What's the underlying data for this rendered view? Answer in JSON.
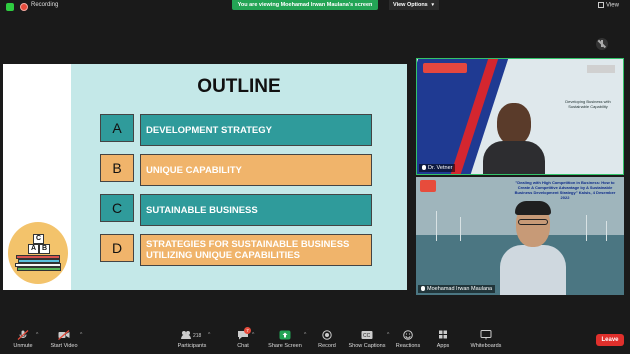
{
  "topbar": {
    "recording_label": "Recording",
    "banner_text": "You are viewing Moehamad Irwan Maulana's screen",
    "view_options_label": "View Options",
    "view_label": "View"
  },
  "slide": {
    "title": "OUTLINE",
    "items": [
      {
        "letter": "A",
        "text": "DEVELOPMENT STRATEGY",
        "color": "#2f9b9b"
      },
      {
        "letter": "B",
        "text": "UNIQUE CAPABILITY",
        "color": "#f0b46b"
      },
      {
        "letter": "C",
        "text": "SUTAINABLE BUSINESS",
        "color": "#2f9b9b"
      },
      {
        "letter": "D",
        "text": "STRATEGIES FOR SUSTAINABLE BUSINESS UTILIZING UNIQUE CAPABILITIES",
        "color": "#f0b46b"
      }
    ],
    "blocks": [
      "C",
      "A",
      "B"
    ]
  },
  "videos": [
    {
      "name": "Dr. Vetner",
      "caption": "Developing Business with Sustainable Capability"
    },
    {
      "name": "Moehamad Irwan Maulana",
      "title": "\"Dealing with High Competition in Business: How to Create A Competitive Advantage by A Sustainable Business Development Strategy\" Kalsis, 4 Desember 2022"
    }
  ],
  "toolbar": {
    "unmute": "Unmute",
    "start_video": "Start Video",
    "participants": "Participants",
    "participants_count": "218",
    "chat": "Chat",
    "chat_badge": "7",
    "share_screen": "Share Screen",
    "record": "Record",
    "show_captions": "Show Captions",
    "reactions": "Reactions",
    "apps": "Apps",
    "whiteboards": "Whiteboards",
    "leave": "Leave"
  },
  "colors": {
    "share_green": "#23a455",
    "leave_red": "#e0302c",
    "slide_bg": "#c4e8e8"
  }
}
